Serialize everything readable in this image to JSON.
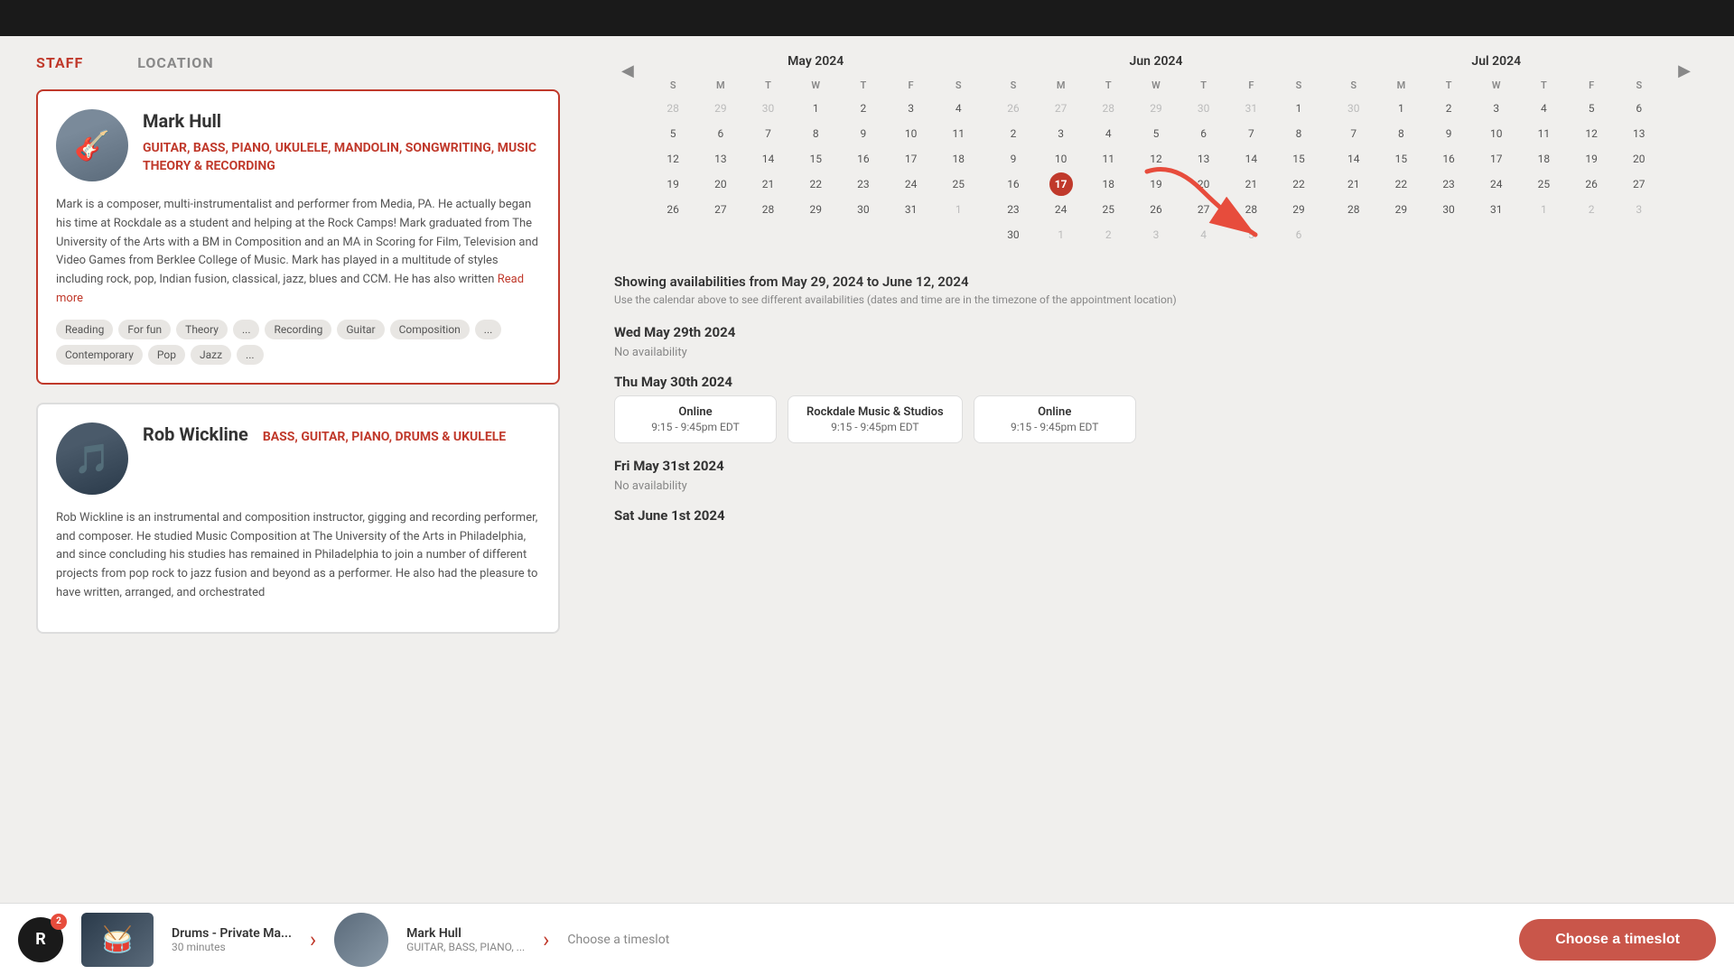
{
  "topBar": {},
  "nav": {
    "staff_label": "STAFF",
    "location_label": "LOCATION"
  },
  "staff": [
    {
      "id": "mark-hull",
      "name_first": "Mark",
      "name_last": "Hull",
      "instruments": "GUITAR, BASS, PIANO, UKULELE, MANDOLIN, SONGWRITING, MUSIC THEORY & RECORDING",
      "bio": "Mark is a composer, multi-instrumentalist and performer from Media, PA. He actually began his time at Rockdale as a student and helping at the Rock Camps! Mark graduated from The University of the Arts with a BM in Composition and an MA in Scoring for Film, Television and Video Games from Berklee College of Music. Mark has played in a multitude of styles including rock, pop, Indian fusion, classical, jazz, blues and CCM. He has also written",
      "read_more": "Read more",
      "tags": [
        "Reading",
        "For fun",
        "Theory",
        "...",
        "Recording",
        "Guitar",
        "Composition",
        "...",
        "Contemporary",
        "Pop",
        "Jazz",
        "..."
      ]
    },
    {
      "id": "rob-wickline",
      "name_first": "Rob",
      "name_last": "Wickline",
      "instruments": "BASS, GUITAR, PIANO, DRUMS & UKULELE",
      "bio": "Rob Wickline is an instrumental and composition instructor, gigging and recording performer, and composer. He studied Music Composition at The University of the Arts in Philadelphia, and since concluding his studies has remained in Philadelphia to join a number of different projects from pop rock to jazz fusion and beyond as a performer. He also had the pleasure to have written, arranged, and orchestrated",
      "tags": []
    }
  ],
  "calendar": {
    "prev_label": "◀",
    "next_label": "▶",
    "months": [
      {
        "title": "May 2024",
        "headers": [
          "S",
          "M",
          "T",
          "W",
          "T",
          "F",
          "S"
        ],
        "weeks": [
          [
            "28",
            "29",
            "30",
            "1",
            "2",
            "3",
            "4"
          ],
          [
            "5",
            "6",
            "7",
            "8",
            "9",
            "10",
            "11"
          ],
          [
            "12",
            "13",
            "14",
            "15",
            "16",
            "17",
            "18"
          ],
          [
            "19",
            "20",
            "21",
            "22",
            "23",
            "24",
            "25"
          ],
          [
            "26",
            "27",
            "28",
            "29",
            "30",
            "31",
            "1"
          ]
        ],
        "other_month_start": [
          "28",
          "29",
          "30"
        ],
        "other_month_end": [
          "1"
        ],
        "selected_day": null
      },
      {
        "title": "Jun 2024",
        "headers": [
          "S",
          "M",
          "T",
          "W",
          "T",
          "F",
          "S"
        ],
        "weeks": [
          [
            "26",
            "27",
            "28",
            "29",
            "30",
            "31",
            "1"
          ],
          [
            "2",
            "3",
            "4",
            "5",
            "6",
            "7",
            "8"
          ],
          [
            "9",
            "10",
            "11",
            "12",
            "13",
            "14",
            "15"
          ],
          [
            "16",
            "17",
            "18",
            "19",
            "20",
            "21",
            "22"
          ],
          [
            "23",
            "24",
            "25",
            "26",
            "27",
            "28",
            "29"
          ],
          [
            "30",
            "1",
            "2",
            "3",
            "4",
            "5",
            "6"
          ]
        ],
        "other_month_start": [
          "26",
          "27",
          "28",
          "29",
          "30",
          "31"
        ],
        "other_month_end": [
          "1",
          "2",
          "3",
          "4",
          "5",
          "6"
        ],
        "selected_day": "17"
      },
      {
        "title": "Jul 2024",
        "headers": [
          "S",
          "M",
          "T",
          "W",
          "T",
          "F",
          "S"
        ],
        "weeks": [
          [
            "30",
            "1",
            "2",
            "3",
            "4",
            "5",
            "6"
          ],
          [
            "7",
            "8",
            "9",
            "10",
            "11",
            "12",
            "13"
          ],
          [
            "14",
            "15",
            "16",
            "17",
            "18",
            "19",
            "20"
          ],
          [
            "21",
            "22",
            "23",
            "24",
            "25",
            "26",
            "27"
          ],
          [
            "28",
            "29",
            "30",
            "31",
            "1",
            "2",
            "3"
          ]
        ],
        "other_month_start": [
          "30"
        ],
        "other_month_end": [
          "1",
          "2",
          "3"
        ],
        "selected_day": null
      }
    ]
  },
  "availability": {
    "showing_text": "Showing availabilities from May 29, 2024 to June 12, 2024",
    "subtitle": "Use the calendar above to see different availabilities (dates and time are in the timezone of the appointment location)",
    "dates": [
      {
        "label": "Wed May 29th 2024",
        "no_availability": "No availability",
        "slots": []
      },
      {
        "label": "Thu May 30th 2024",
        "no_availability": null,
        "slots": [
          {
            "location": "Online",
            "time": "9:15 - 9:45pm EDT"
          },
          {
            "location": "Rockdale Music & Studios",
            "time": "9:15 - 9:45pm EDT"
          },
          {
            "location": "Online",
            "time": "9:15 - 9:45pm EDT"
          }
        ]
      },
      {
        "label": "Fri May 31st 2024",
        "no_availability": "No availability",
        "slots": []
      },
      {
        "label": "Sat June 1st 2024",
        "no_availability": null,
        "slots": []
      }
    ]
  },
  "bottom_bar": {
    "logo_letter": "R",
    "badge_count": "2",
    "service_name": "Drums - Private Ma...",
    "service_duration": "30 minutes",
    "staff_name": "Mark Hull",
    "staff_instruments": "GUITAR, BASS, PIANO, ...",
    "timeslot_label": "Choose a timeslot",
    "cta_label": "Choose a timeslot"
  }
}
